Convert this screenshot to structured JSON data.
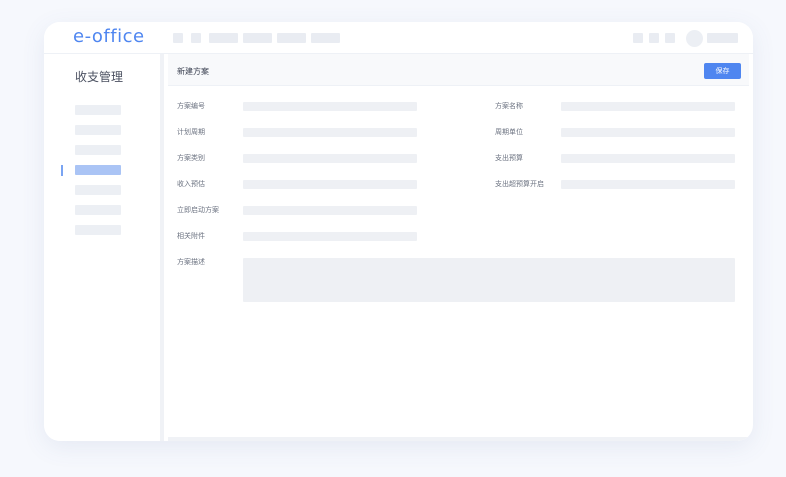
{
  "app": {
    "logo": "e-office"
  },
  "sidebar": {
    "title": "收支管理",
    "active_index": 3,
    "item_count": 7
  },
  "main": {
    "title": "新建方案",
    "save_label": "保存"
  },
  "form": {
    "left": [
      {
        "label": "方案编号"
      },
      {
        "label": "计划周期"
      },
      {
        "label": "方案类别"
      },
      {
        "label": "收入预估"
      },
      {
        "label": "立即启动方案"
      },
      {
        "label": "相关附件"
      }
    ],
    "right": [
      {
        "label": "方案名称"
      },
      {
        "label": "周期单位"
      },
      {
        "label": "支出预算"
      },
      {
        "label": "支出超预算开启"
      }
    ],
    "description": {
      "label": "方案描述"
    }
  }
}
